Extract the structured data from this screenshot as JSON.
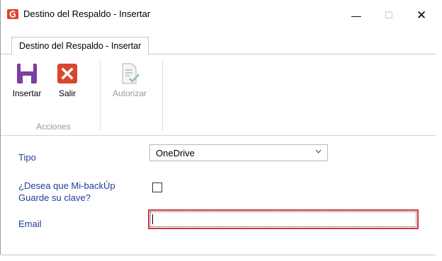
{
  "window": {
    "title": "Destino del Respaldo - Insertar",
    "minimize_glyph": "—",
    "maximize_glyph": "☐",
    "close_glyph": "✕"
  },
  "ribbon": {
    "tab_label": "Destino del Respaldo - Insertar",
    "buttons": {
      "insertar": "Insertar",
      "salir": "Salir",
      "autorizar": "Autorizar"
    },
    "group_label": "Acciones"
  },
  "form": {
    "tipo_label": "Tipo",
    "tipo_value": "OneDrive",
    "guardar_clave_label": "¿Desea que Mi-backÚp Guarde su clave?",
    "guardar_clave_checked": false,
    "email_label": "Email",
    "email_value": ""
  },
  "colors": {
    "accent_red": "#d3363f",
    "label_blue": "#1f3d99",
    "save_icon_purple": "#7b3fa0"
  },
  "icons": {
    "app": "app-logo-icon",
    "insertar": "save-icon",
    "salir": "close-x-icon",
    "autorizar": "document-check-icon",
    "dropdown": "chevron-down-icon"
  }
}
